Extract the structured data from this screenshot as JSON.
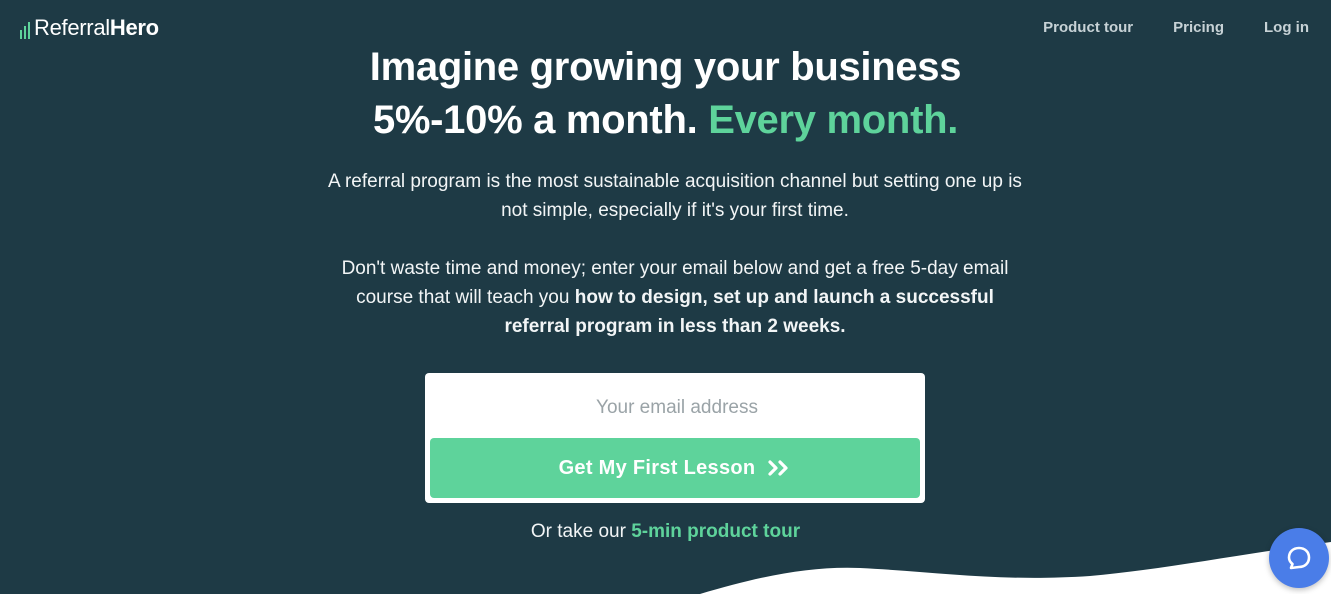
{
  "brand": {
    "part1": "Referral",
    "part2": "Hero",
    "accent": "#5ed39b"
  },
  "nav": {
    "items": [
      "Product tour",
      "Pricing",
      "Log in"
    ]
  },
  "hero": {
    "headline_line1": "Imagine growing your business",
    "headline_line2_white": "5%-10% a month.",
    "headline_line2_accent": "Every month.",
    "paragraph1": "A referral program is the most sustainable acquisition channel but setting one up is not simple, especially if it's your first time.",
    "paragraph2_normal": "Don't waste time and money; enter your email below and get a free 5-day email course that will teach you",
    "paragraph2_bold": "how to design, set up and launch a successful referral program in less than 2 weeks."
  },
  "form": {
    "email_placeholder": "Your email address",
    "email_value": "",
    "button_label": "Get My First Lesson",
    "button_icon": "double-chevron-right-icon"
  },
  "tour": {
    "prefix": "Or take our",
    "link_text": "5-min product tour"
  },
  "chat": {
    "icon": "chat-bubble-icon"
  },
  "colors": {
    "background": "#1e3a45",
    "accent": "#5ed39b",
    "chat": "#4a7de8",
    "card": "#ffffff"
  }
}
